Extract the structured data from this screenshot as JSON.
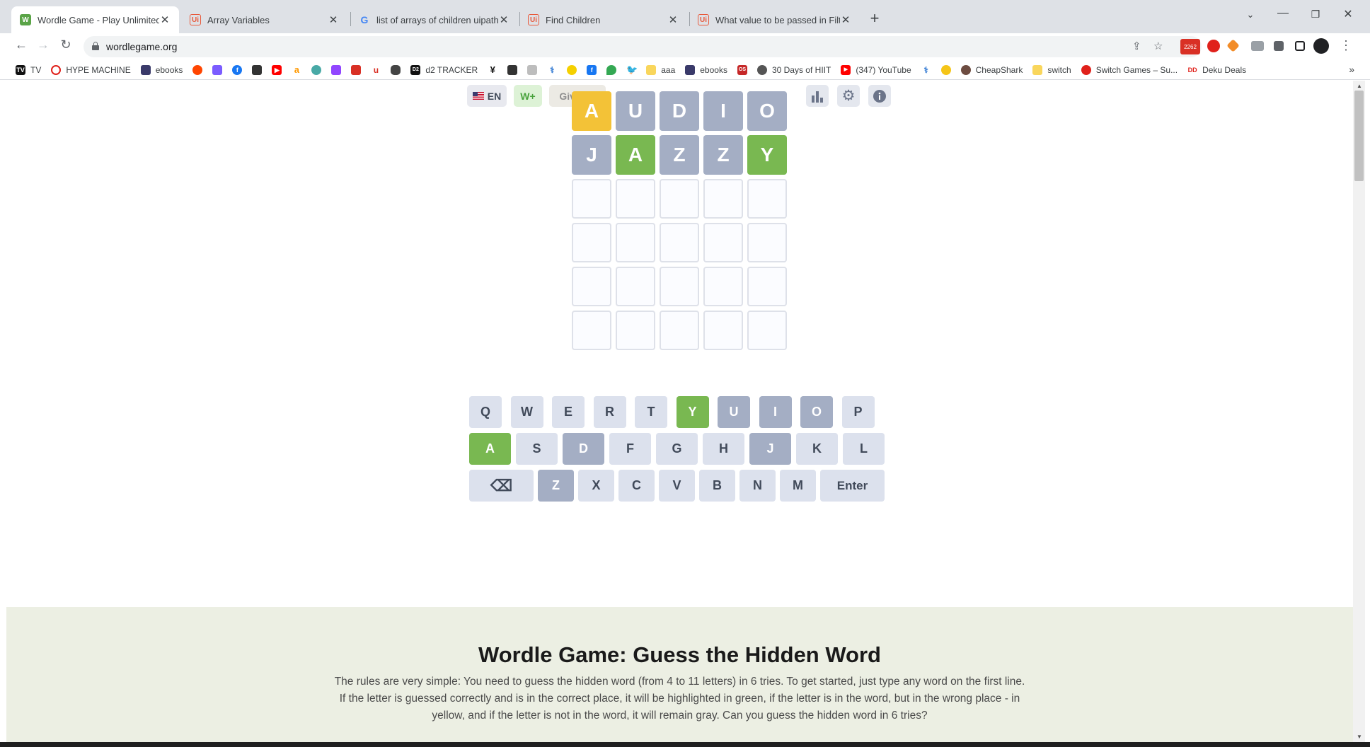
{
  "browser": {
    "tabs": [
      {
        "title": "Wordle Game - Play Unlimited",
        "favicon": "wordle-icon",
        "active": true
      },
      {
        "title": "Array Variables",
        "favicon": "uipath-icon"
      },
      {
        "title": "list of arrays of children uipath - G",
        "favicon": "google-icon"
      },
      {
        "title": "Find Children",
        "favicon": "uipath-icon"
      },
      {
        "title": "What value to be passed in Filter",
        "favicon": "uipath-icon"
      }
    ],
    "url": "wordlegame.org",
    "extension_badge": "2262",
    "bookmarks": [
      "TV",
      "HYPE MACHINE",
      "ebooks",
      "d2 TRACKER",
      "aaa",
      "ebooks",
      "30 Days of HIIT",
      "(347) YouTube",
      "CheapShark",
      "switch",
      "Switch Games – Su...",
      "Deku Deals"
    ]
  },
  "game": {
    "language_label": "EN",
    "wplus_label": "W+",
    "giveup_label": "Give up",
    "board": [
      [
        {
          "l": "A",
          "s": "yellow"
        },
        {
          "l": "U",
          "s": "gray"
        },
        {
          "l": "D",
          "s": "gray"
        },
        {
          "l": "I",
          "s": "gray"
        },
        {
          "l": "O",
          "s": "gray"
        }
      ],
      [
        {
          "l": "J",
          "s": "gray"
        },
        {
          "l": "A",
          "s": "green"
        },
        {
          "l": "Z",
          "s": "gray"
        },
        {
          "l": "Z",
          "s": "gray"
        },
        {
          "l": "Y",
          "s": "green"
        }
      ],
      [
        {
          "l": "",
          "s": "empty"
        },
        {
          "l": "",
          "s": "empty"
        },
        {
          "l": "",
          "s": "empty"
        },
        {
          "l": "",
          "s": "empty"
        },
        {
          "l": "",
          "s": "empty"
        }
      ],
      [
        {
          "l": "",
          "s": "empty"
        },
        {
          "l": "",
          "s": "empty"
        },
        {
          "l": "",
          "s": "empty"
        },
        {
          "l": "",
          "s": "empty"
        },
        {
          "l": "",
          "s": "empty"
        }
      ],
      [
        {
          "l": "",
          "s": "empty"
        },
        {
          "l": "",
          "s": "empty"
        },
        {
          "l": "",
          "s": "empty"
        },
        {
          "l": "",
          "s": "empty"
        },
        {
          "l": "",
          "s": "empty"
        }
      ],
      [
        {
          "l": "",
          "s": "empty"
        },
        {
          "l": "",
          "s": "empty"
        },
        {
          "l": "",
          "s": "empty"
        },
        {
          "l": "",
          "s": "empty"
        },
        {
          "l": "",
          "s": "empty"
        }
      ]
    ],
    "keyboard": [
      [
        {
          "k": "Q"
        },
        {
          "k": "W"
        },
        {
          "k": "E"
        },
        {
          "k": "R"
        },
        {
          "k": "T"
        },
        {
          "k": "Y",
          "s": "green"
        },
        {
          "k": "U",
          "s": "gray"
        },
        {
          "k": "I",
          "s": "gray"
        },
        {
          "k": "O",
          "s": "gray"
        },
        {
          "k": "P"
        }
      ],
      [
        {
          "k": "A",
          "s": "green"
        },
        {
          "k": "S"
        },
        {
          "k": "D",
          "s": "gray"
        },
        {
          "k": "F"
        },
        {
          "k": "G"
        },
        {
          "k": "H"
        },
        {
          "k": "J",
          "s": "gray"
        },
        {
          "k": "K"
        },
        {
          "k": "L"
        }
      ],
      [
        {
          "k": "⌫",
          "name": "backspace"
        },
        {
          "k": "Z",
          "s": "gray"
        },
        {
          "k": "X"
        },
        {
          "k": "C"
        },
        {
          "k": "V"
        },
        {
          "k": "B"
        },
        {
          "k": "N"
        },
        {
          "k": "M"
        },
        {
          "k": "Enter",
          "name": "enter"
        }
      ]
    ],
    "colors": {
      "green": "#79b851",
      "yellow": "#f3c237",
      "gray": "#a4aec4"
    }
  },
  "info": {
    "title": "Wordle Game: Guess the Hidden Word",
    "text": "The rules are very simple: You need to guess the hidden word (from 4 to 11 letters) in 6 tries. To get started, just type any word on the first line. If the letter is guessed correctly and is in the correct place, it will be highlighted in green, if the letter is in the word, but in the wrong place - in yellow, and if the letter is not in the word, it will remain gray. Can you guess the hidden word in 6 tries?"
  }
}
